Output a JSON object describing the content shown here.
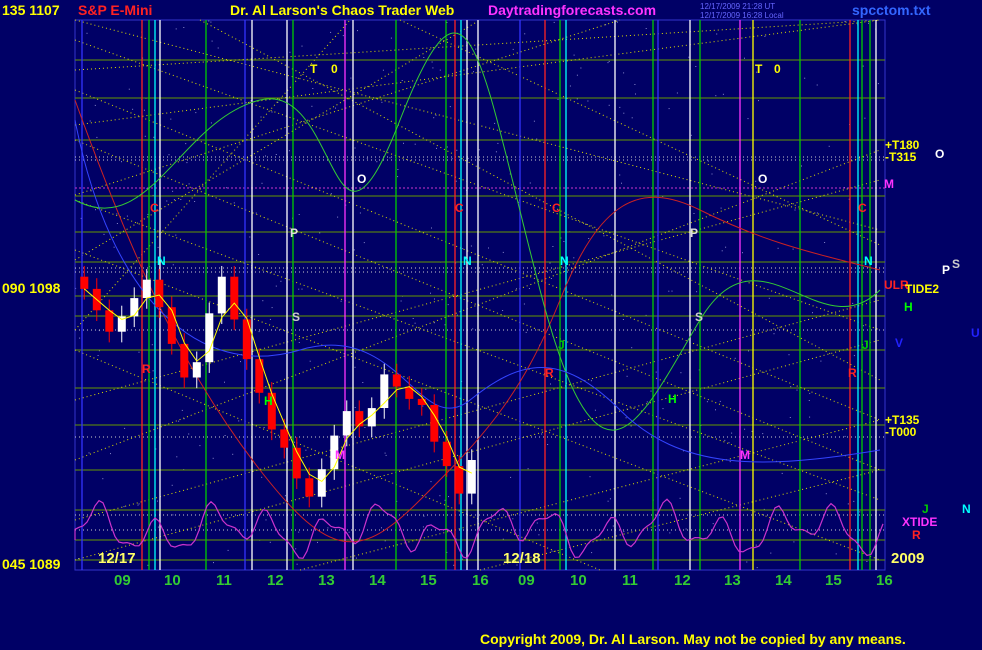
{
  "header": {
    "left_title": "135  1107",
    "instrument": "S&P E-Mini",
    "title": "Dr. Al Larson's Chaos Trader Web",
    "site": "Daytradingforecasts.com",
    "stamp1": "12/17/2009 21:28 UT",
    "stamp2": "12/17/2009 16:28 Local",
    "file": "spcctom.txt"
  },
  "y_labels": [
    "090  1098",
    "045  1089"
  ],
  "dates": [
    "12/17",
    "12/18",
    "2009"
  ],
  "x_ticks": [
    "09",
    "10",
    "11",
    "12",
    "13",
    "14",
    "15",
    "16",
    "09",
    "10",
    "11",
    "12",
    "13",
    "14",
    "15",
    "16"
  ],
  "right_labels": [
    "+T180",
    "-T315",
    "+T135",
    "-T000"
  ],
  "planet_marks": [
    {
      "t": "T",
      "c": "#ffff00"
    },
    {
      "t": "0",
      "c": "#ffff00"
    },
    {
      "t": "T",
      "c": "#ffff00"
    },
    {
      "t": "0",
      "c": "#ffff00"
    },
    {
      "t": "O",
      "c": "#ffffff"
    },
    {
      "t": "O",
      "c": "#ffffff"
    },
    {
      "t": "O",
      "c": "#ffffff"
    },
    {
      "t": "M",
      "c": "#ff33ff"
    },
    {
      "t": "C",
      "c": "#ff2222"
    },
    {
      "t": "C",
      "c": "#ff2222"
    },
    {
      "t": "C",
      "c": "#ff2222"
    },
    {
      "t": "C",
      "c": "#ff2222"
    },
    {
      "t": "P",
      "c": "#dddddd"
    },
    {
      "t": "P",
      "c": "#dddddd"
    },
    {
      "t": "N",
      "c": "#00ffff"
    },
    {
      "t": "N",
      "c": "#00ffff"
    },
    {
      "t": "N",
      "c": "#00ffff"
    },
    {
      "t": "N",
      "c": "#00ffff"
    },
    {
      "t": "P",
      "c": "#ffffff"
    },
    {
      "t": "S",
      "c": "#cccccc"
    },
    {
      "t": "ULR",
      "c": "#ff2222"
    },
    {
      "t": "TIDE2",
      "c": "#ffff00"
    },
    {
      "t": "H",
      "c": "#00ff00"
    },
    {
      "t": "S",
      "c": "#cccccc"
    },
    {
      "t": "S",
      "c": "#cccccc"
    },
    {
      "t": "U",
      "c": "#2222ff"
    },
    {
      "t": "V",
      "c": "#2222ff"
    },
    {
      "t": "J",
      "c": "#00cc00"
    },
    {
      "t": "J",
      "c": "#00cc00"
    },
    {
      "t": "R",
      "c": "#ff2222"
    },
    {
      "t": "R",
      "c": "#ff2222"
    },
    {
      "t": "R",
      "c": "#ff2222"
    },
    {
      "t": "H",
      "c": "#00ff00"
    },
    {
      "t": "H",
      "c": "#00ff00"
    },
    {
      "t": "M",
      "c": "#ff33ff"
    },
    {
      "t": "M",
      "c": "#ff33ff"
    },
    {
      "t": "J",
      "c": "#00cc00"
    },
    {
      "t": "N",
      "c": "#00ffff"
    },
    {
      "t": "XTIDE",
      "c": "#ff33ff"
    },
    {
      "t": "R",
      "c": "#ff2222"
    }
  ],
  "copyright": "Copyright 2009, Dr. Al Larson.  May not be copied by any means.",
  "colors": {
    "background": "#000066",
    "bull": "#ffffff",
    "bear": "#ff0000",
    "grid": "#669900",
    "tide": "#cc33cc"
  },
  "chart_data": {
    "type": "candlestick",
    "y_ticks": [
      1089,
      1098,
      1107
    ],
    "ylim": [
      1089,
      1107
    ],
    "sessions": [
      "12/17",
      "12/18"
    ],
    "xtick_hours": [
      9,
      10,
      11,
      12,
      13,
      14,
      15,
      16,
      9,
      10,
      11,
      12,
      13,
      14,
      15,
      16
    ],
    "series": [
      {
        "name": "S&P E-Mini 12/17 closes",
        "color": "#ff0000",
        "values": [
          1098.2,
          1097.5,
          1096.8,
          1097.3,
          1097.9,
          1098.5,
          1097.6,
          1096.4,
          1095.3,
          1095.8,
          1097.4,
          1098.6,
          1097.2,
          1095.9,
          1094.8,
          1093.6,
          1093.0,
          1092.0,
          1091.4,
          1092.3,
          1093.4,
          1094.2,
          1093.7,
          1094.3,
          1095.4,
          1095.0,
          1094.6,
          1094.4,
          1093.2,
          1092.4,
          1091.5,
          1092.6
        ]
      }
    ]
  }
}
